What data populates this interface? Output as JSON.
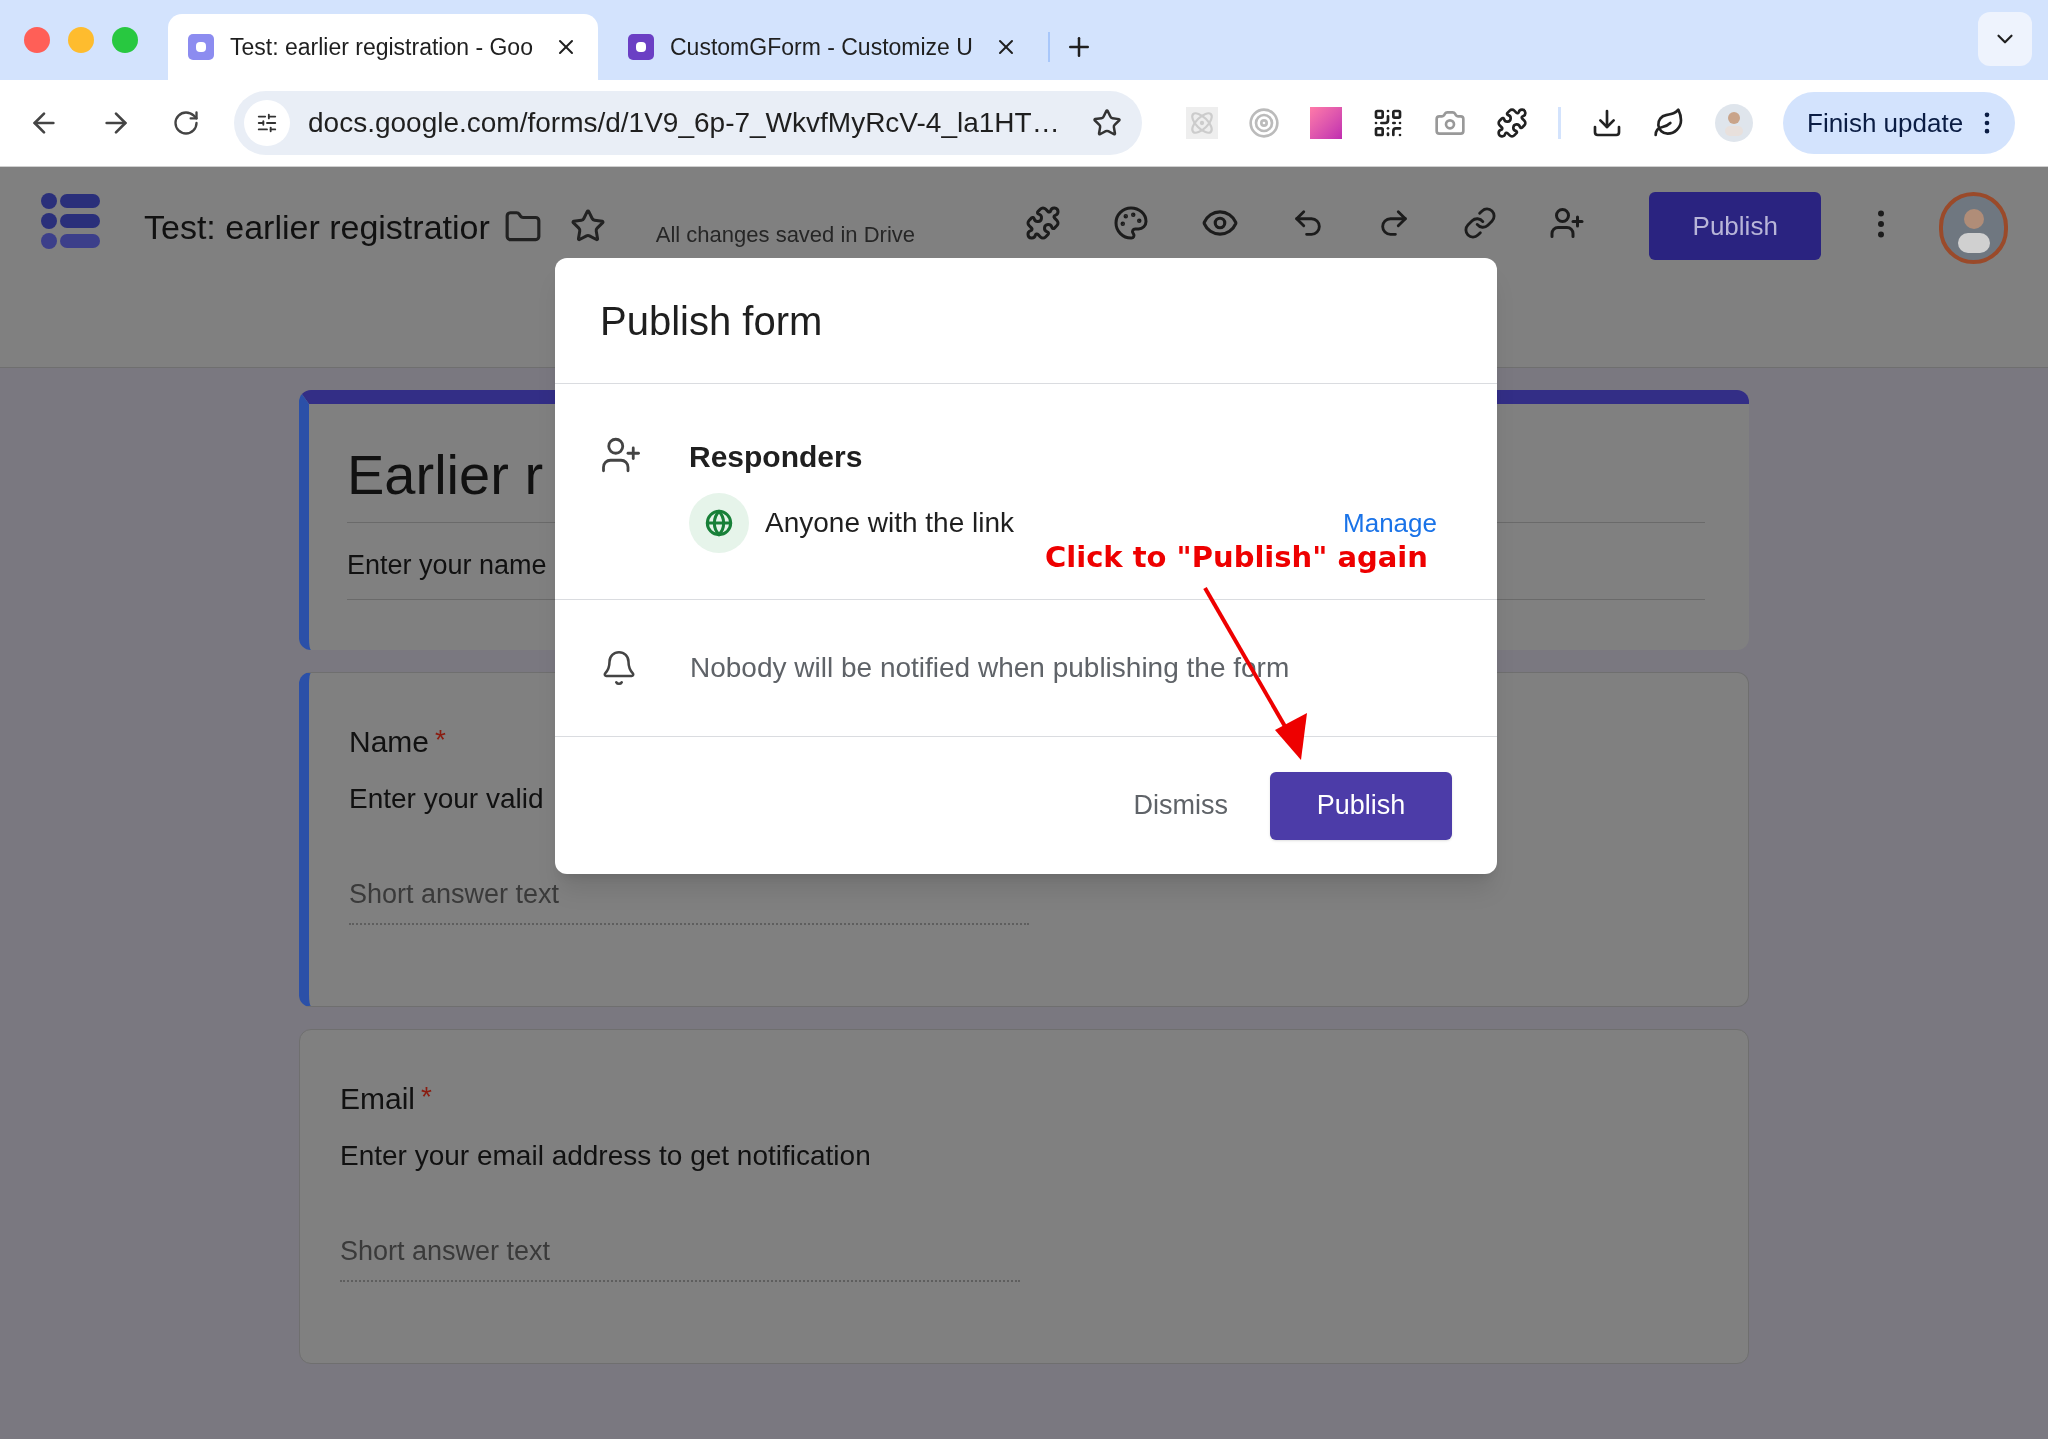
{
  "browser": {
    "tabs": [
      {
        "title": "Test: earlier registration - Goo",
        "selected": true
      },
      {
        "title": "CustomGForm - Customize U",
        "selected": false
      }
    ],
    "url": "docs.google.com/forms/d/1V9_6p-7_WkvfMyRcV-4_la1HT…",
    "update_button": "Finish update"
  },
  "app_bar": {
    "title": "Test: earlier registratior",
    "save_status": "All changes saved in Drive",
    "publish_button": "Publish"
  },
  "form": {
    "title": "Earlier r",
    "description": "Enter your name",
    "highlighted": true,
    "questions": [
      {
        "title": "Name",
        "required_mark": "*",
        "description": "Enter your valid",
        "placeholder": "Short answer text",
        "highlighted": true
      },
      {
        "title": "Email",
        "required_mark": "*",
        "description": "Enter your email address to get notification",
        "placeholder": "Short answer text",
        "highlighted": false
      }
    ]
  },
  "dialog": {
    "title": "Publish form",
    "responders_heading": "Responders",
    "access": "Anyone with the link",
    "manage_link": "Manage",
    "notice": "Nobody will be notified when publishing the form",
    "dismiss_button": "Dismiss",
    "publish_button": "Publish"
  },
  "annotation": {
    "text": "Click to \"Publish\" again"
  }
}
